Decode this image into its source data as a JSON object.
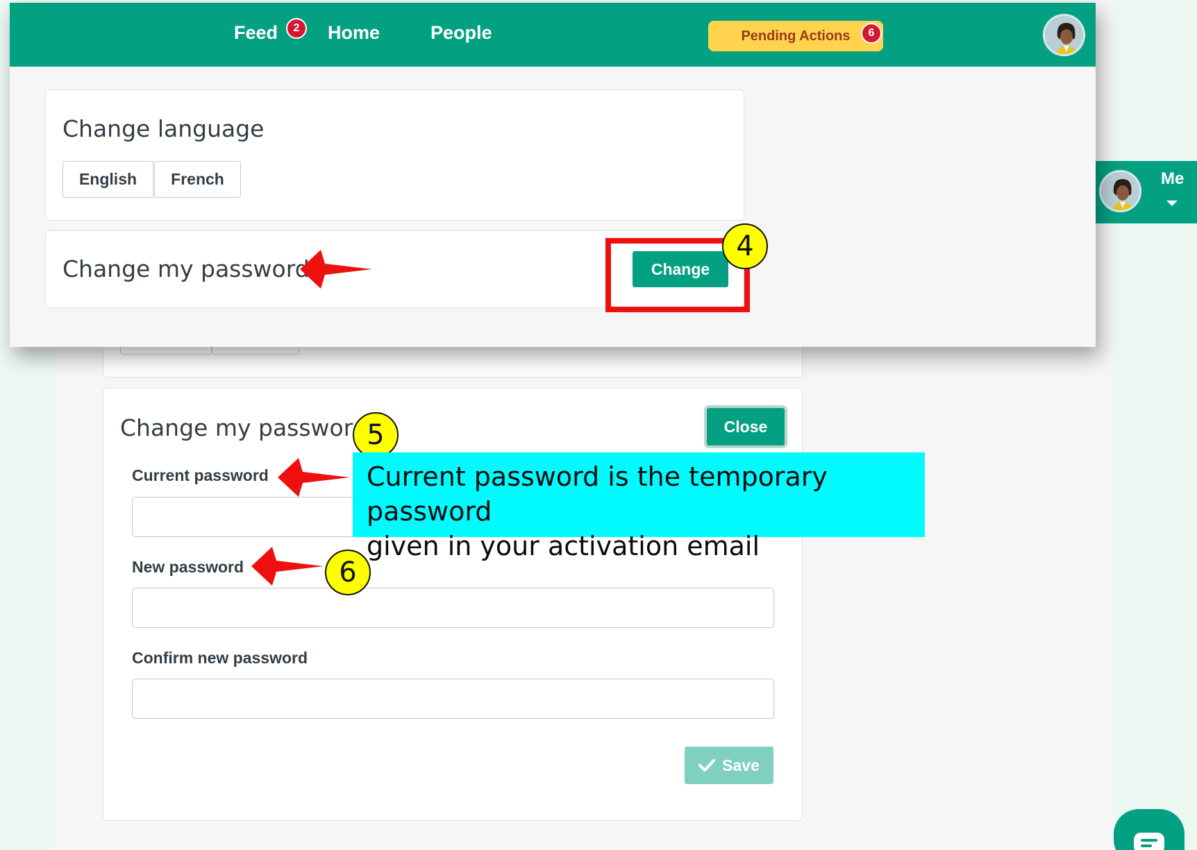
{
  "nav": {
    "feed": "Feed",
    "feed_badge": "2",
    "home": "Home",
    "people": "People",
    "pending_actions": "Pending Actions",
    "pending_badge": "6"
  },
  "language_card": {
    "title": "Change language",
    "english": "English",
    "french": "French"
  },
  "password_row": {
    "title": "Change my password",
    "change_button": "Change"
  },
  "background_header": {
    "me_label": "Me"
  },
  "password_form": {
    "title": "Change my password",
    "close_button": "Close",
    "current_label": "Current password",
    "new_label": "New password",
    "confirm_label": "Confirm new password",
    "save_button": "Save"
  },
  "annotations": {
    "step4": "4",
    "step5": "5",
    "step6": "6",
    "callout_line1": "Current password is the temporary password",
    "callout_line2": "given in your activation email"
  },
  "colors": {
    "brand": "#03a182",
    "badge": "#d41830",
    "pending": "#ffd34e",
    "annotation_red": "#ee0f0f",
    "annotation_yellow": "#ffff00",
    "callout_cyan": "#00fbff"
  }
}
